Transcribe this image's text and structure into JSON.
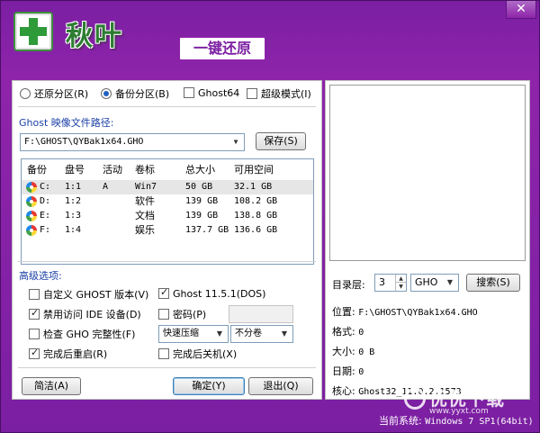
{
  "header": {
    "title": "秋叶",
    "subtitle": "一键还原",
    "close_label": "✕"
  },
  "mode_options": [
    {
      "label": "还原分区(R)",
      "type": "radio",
      "checked": false
    },
    {
      "label": "备份分区(B)",
      "type": "radio",
      "checked": true
    },
    {
      "label": "Ghost64",
      "type": "checkbox",
      "checked": false
    },
    {
      "label": "超级模式(I)",
      "type": "checkbox",
      "checked": false
    }
  ],
  "ghost_path": {
    "label": "Ghost 映像文件路径:",
    "value": "F:\\GHOST\\QYBak1x64.GHO",
    "save_label": "保存(S)"
  },
  "table": {
    "headers": [
      "备份",
      "盘号",
      "活动",
      "卷标",
      "总大小",
      "可用空间"
    ],
    "rows": [
      {
        "drive": "C:",
        "disk": "1:1",
        "active": "A",
        "label": "Win7",
        "total": "50 GB",
        "free": "32.1 GB"
      },
      {
        "drive": "D:",
        "disk": "1:2",
        "active": "",
        "label": "软件",
        "total": "139 GB",
        "free": "108.2 GB"
      },
      {
        "drive": "E:",
        "disk": "1:3",
        "active": "",
        "label": "文档",
        "total": "139 GB",
        "free": "138.8 GB"
      },
      {
        "drive": "F:",
        "disk": "1:4",
        "active": "",
        "label": "娱乐",
        "total": "137.7 GB",
        "free": "136.6 GB"
      }
    ]
  },
  "advanced": {
    "title": "高级选项:",
    "left": [
      {
        "label": "自定义 GHOST 版本(V)",
        "checked": false
      },
      {
        "label": "禁用访问 IDE 设备(D)",
        "checked": true
      },
      {
        "label": "检查 GHO 完整性(F)",
        "checked": false
      },
      {
        "label": "完成后重启(R)",
        "checked": true
      }
    ],
    "right": [
      {
        "label": "Ghost 11.5.1(DOS)",
        "checked": true
      },
      {
        "label": "密码(P)",
        "checked": false
      },
      {
        "label": "完成后关机(X)",
        "checked": false
      }
    ],
    "compress_value": "快速压缩",
    "split_value": "不分卷"
  },
  "buttons": {
    "simple": "简洁(A)",
    "ok": "确定(Y)",
    "exit": "退出(Q)"
  },
  "right_panel": {
    "dir_level_label": "目录层:",
    "dir_level_value": "3",
    "ext_value": "GHO",
    "search_label": "搜索(S)",
    "position_label": "位置:",
    "position_value": "F:\\GHOST\\QYBak1x64.GHO",
    "format_label": "格式:",
    "format_value": "0",
    "size_label": "大小:",
    "size_value": "0 B",
    "date_label": "日期:",
    "date_value": "0",
    "core_label": "核心:",
    "core_value": "Ghost32_11.0.2.1573"
  },
  "status_bar": {
    "label": "当前系统:",
    "value": "Windows 7 SP1(64bit)"
  },
  "watermark": {
    "text": "优优下载",
    "url": "www.yyxt.com"
  },
  "colors": {
    "window_bg": "#7b1fa2",
    "title_green": "#2e7d32",
    "label_blue": "#1a3fa6"
  }
}
